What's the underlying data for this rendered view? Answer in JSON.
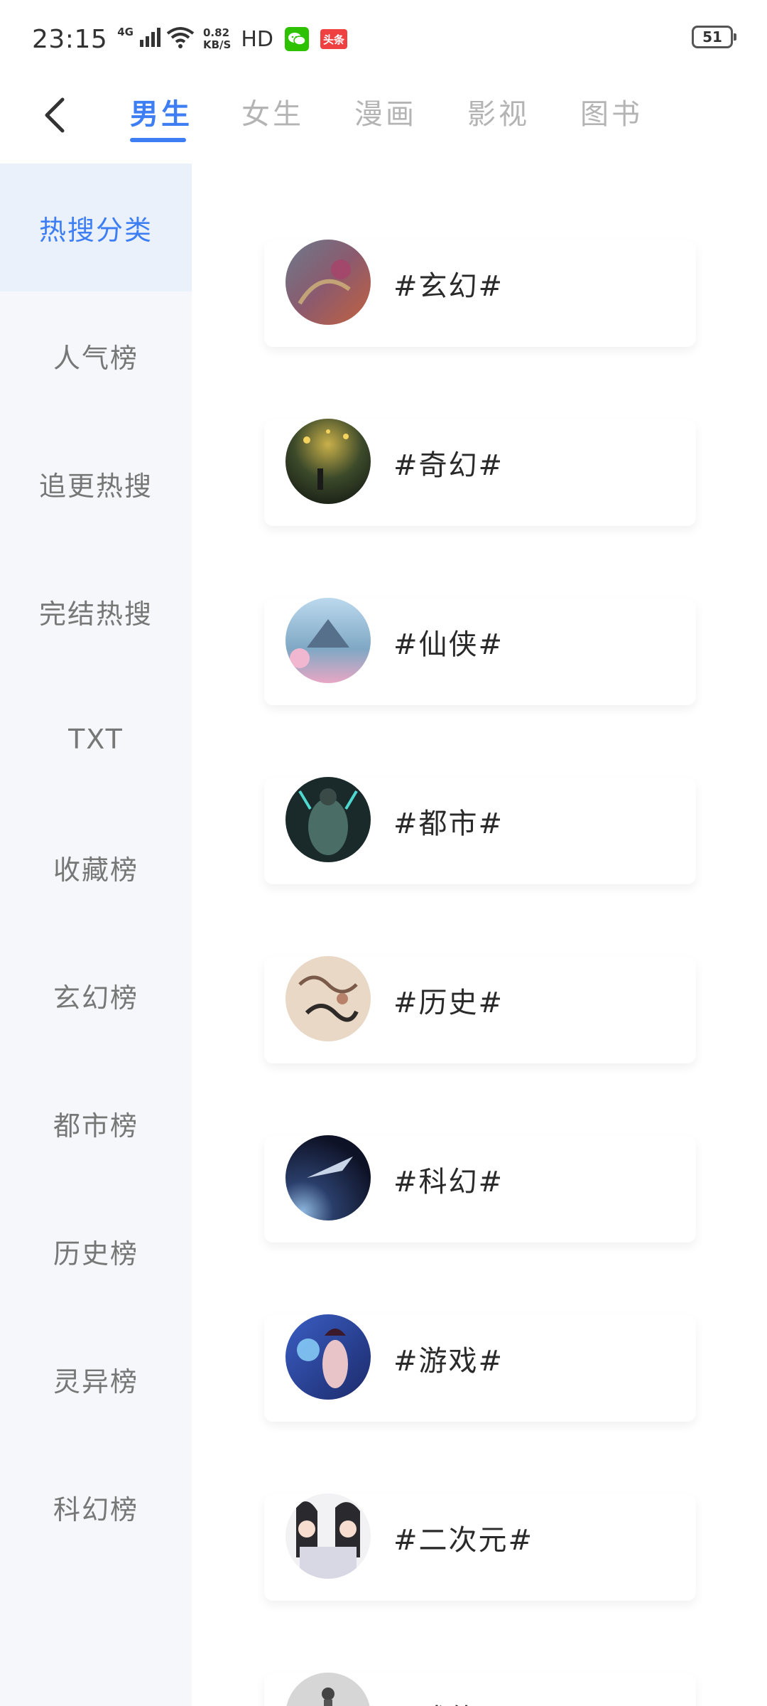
{
  "status": {
    "time": "23:15",
    "network": "4G",
    "speed_value": "0.82",
    "speed_unit": "KB/S",
    "hd": "HD",
    "toutiao_label": "头条",
    "battery": "51"
  },
  "header": {
    "tabs": [
      {
        "label": "男生"
      },
      {
        "label": "女生"
      },
      {
        "label": "漫画"
      },
      {
        "label": "影视"
      },
      {
        "label": "图书"
      }
    ]
  },
  "sidebar": {
    "items": [
      {
        "label": "热搜分类"
      },
      {
        "label": "人气榜"
      },
      {
        "label": "追更热搜"
      },
      {
        "label": "完结热搜"
      },
      {
        "label": "TXT"
      },
      {
        "label": "收藏榜"
      },
      {
        "label": "玄幻榜"
      },
      {
        "label": "都市榜"
      },
      {
        "label": "历史榜"
      },
      {
        "label": "灵异榜"
      },
      {
        "label": "科幻榜"
      }
    ]
  },
  "categories": [
    {
      "label": "#玄幻#"
    },
    {
      "label": "#奇幻#"
    },
    {
      "label": "#仙侠#"
    },
    {
      "label": "#都市#"
    },
    {
      "label": "#历史#"
    },
    {
      "label": "#科幻#"
    },
    {
      "label": "#游戏#"
    },
    {
      "label": "#二次元#"
    },
    {
      "label": "#武侠#"
    }
  ],
  "colors": {
    "accent": "#3d7ef4",
    "sidebar_bg": "#f5f7fb",
    "sidebar_active_bg": "#eaf1fb"
  }
}
